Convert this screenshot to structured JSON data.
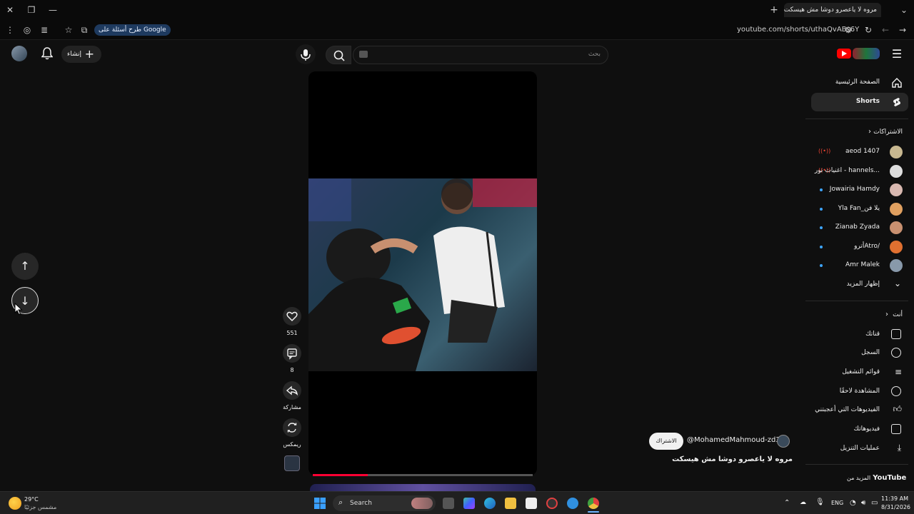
{
  "browser": {
    "tab_title": "مروه لا ياعصرو دوشا مش هيسكت",
    "new_tab": "+",
    "minimize": "—",
    "restore": "❐",
    "close": "✕",
    "ask_google": "طرح أسئلة على Google",
    "url": "youtube.com/shorts/uthaQvABs6Y"
  },
  "masthead": {
    "create_label": "إنشاء",
    "search_placeholder": "بحث",
    "menu_icon": "menu-icon",
    "notifications_icon": "bell-icon",
    "brand_color": "#ff0000"
  },
  "sidebar": {
    "main": [
      {
        "label": "الصفحة الرئيسية",
        "icon": "home-icon"
      },
      {
        "label": "Shorts",
        "icon": "shorts-icon",
        "active": true
      }
    ],
    "subscriptions_header": "الاشتراكات",
    "subscriptions": [
      {
        "label": "aeod 1407",
        "live": true,
        "color": "#c8b890"
      },
      {
        "label": "اغنيات نور - hannels...",
        "live": true,
        "color": "#dddddd"
      },
      {
        "label": "Jowairia Hamdy",
        "live": false,
        "color": "#d8b8b0"
      },
      {
        "label": "Yla Fan_يلا فن",
        "live": false,
        "color": "#e0a060"
      },
      {
        "label": "Zianab Zyada",
        "live": false,
        "color": "#c89070"
      },
      {
        "label": "أتروAtro/",
        "live": false,
        "color": "#e07030"
      },
      {
        "label": "Amr Malek",
        "live": false,
        "color": "#8899aa"
      }
    ],
    "show_more": "إظهار المزيد",
    "you_header": "أنت",
    "you": [
      {
        "label": "قناتك",
        "icon": "channel-icon"
      },
      {
        "label": "السجل",
        "icon": "history-icon"
      },
      {
        "label": "قوائم التشغيل",
        "icon": "playlists-icon"
      },
      {
        "label": "المشاهدة لاحقًا",
        "icon": "clock-icon"
      },
      {
        "label": "الفيديوهات التي أعجبتني",
        "icon": "thumb-up-icon"
      },
      {
        "label": "فيديوهاتك",
        "icon": "video-icon"
      },
      {
        "label": "عمليات التنزيل",
        "icon": "download-icon"
      }
    ],
    "more_from": "المزيد من",
    "more_from_brand": "YouTube"
  },
  "shorts": {
    "likes": "551",
    "comments": "8",
    "share": "مشاركة",
    "remix": "ريمكس",
    "subscribe": "الاشتراك",
    "handle": "@MohamedMahmoud-zd3iq",
    "title": "مروه لا ياعصرو دوشا مش هيسكت",
    "progress": 0.25
  },
  "taskbar": {
    "weather_temp": "29°C",
    "weather_desc": "مشمس جزئيًا",
    "search": "Search",
    "lang": "ENG",
    "time": "11:39 AM",
    "date": "8/31/2026"
  }
}
